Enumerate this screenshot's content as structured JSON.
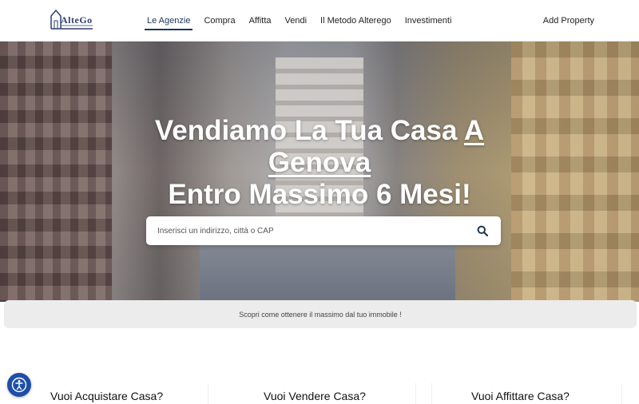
{
  "brand": {
    "logo_text": "AlteGo"
  },
  "nav": {
    "items": [
      {
        "label": "Le Agenzie",
        "active": true
      },
      {
        "label": "Compra",
        "active": false
      },
      {
        "label": "Affitta",
        "active": false
      },
      {
        "label": "Vendi",
        "active": false
      },
      {
        "label": "Il Metodo Alterego",
        "active": false
      },
      {
        "label": "Investimenti",
        "active": false
      }
    ],
    "add_property": "Add Property"
  },
  "hero": {
    "line1_prefix": "Vendiamo La Tua Casa ",
    "line1_underlined": "A",
    "line2_underlined": "Genova",
    "line3": "Entro Massimo 6 Mesi!",
    "search_placeholder": "Inserisci un indirizzo, città o CAP"
  },
  "banner": {
    "text": "Scopri come ottenere il massimo dal tuo immobile !"
  },
  "cards": [
    {
      "title": "Vuoi Acquistare Casa?"
    },
    {
      "title": "Vuoi Vendere Casa?"
    },
    {
      "title": "Vuoi Affittare Casa?"
    }
  ],
  "icons": {
    "search": "search-icon",
    "accessibility": "accessibility-icon"
  },
  "colors": {
    "accent": "#1d3557",
    "accessibility_button": "#1e4fa8",
    "banner_bg": "#ececec"
  }
}
